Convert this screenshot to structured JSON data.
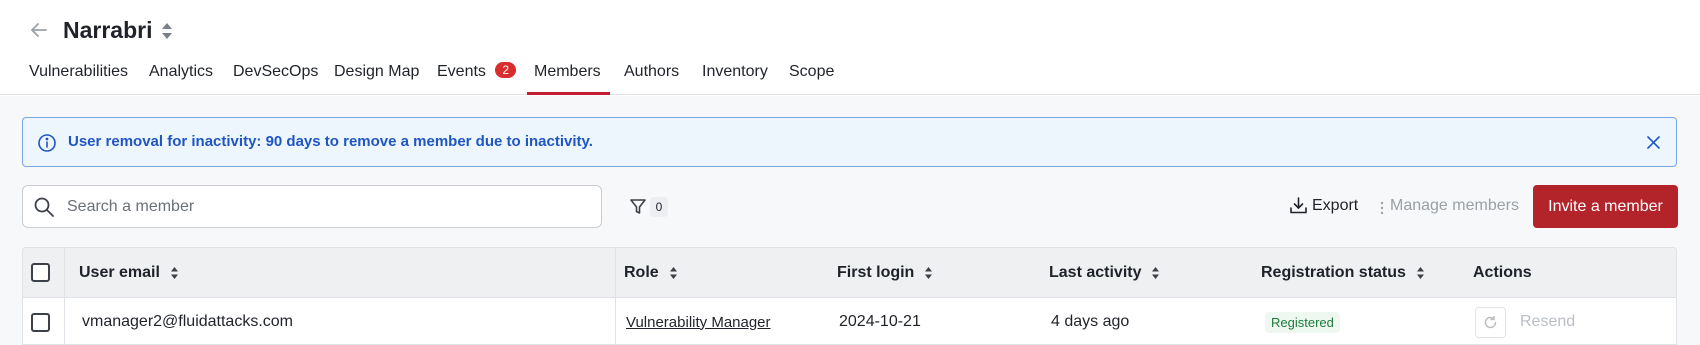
{
  "header": {
    "title": "Narrabri",
    "tabs": [
      {
        "label": "Vulnerabilities"
      },
      {
        "label": "Analytics"
      },
      {
        "label": "DevSecOps"
      },
      {
        "label": "Design Map"
      },
      {
        "label": "Events",
        "badge": "2"
      },
      {
        "label": "Members",
        "active": true
      },
      {
        "label": "Authors"
      },
      {
        "label": "Inventory"
      },
      {
        "label": "Scope"
      }
    ]
  },
  "alert": {
    "text": "User removal for inactivity: 90 days to remove a member due to inactivity."
  },
  "toolbar": {
    "search_placeholder": "Search a member",
    "filter_count": "0",
    "export_label": "Export",
    "manage_label": "Manage members",
    "invite_label": "Invite a member"
  },
  "table": {
    "columns": [
      "User email",
      "Role",
      "First login",
      "Last activity",
      "Registration status",
      "Actions"
    ],
    "rows": [
      {
        "email": "vmanager2@fluidattacks.com",
        "role": "Vulnerability Manager",
        "first_login": "2024-10-21",
        "last_activity": "4 days ago",
        "registration_status": "Registered",
        "action_label": "Resend"
      }
    ]
  },
  "colors": {
    "accent": "#b3242a",
    "tab_underline": "#bf1f2f",
    "info_text": "#1f56c4",
    "info_bg": "#eef6fd",
    "status_green": "#1d7a3a"
  }
}
